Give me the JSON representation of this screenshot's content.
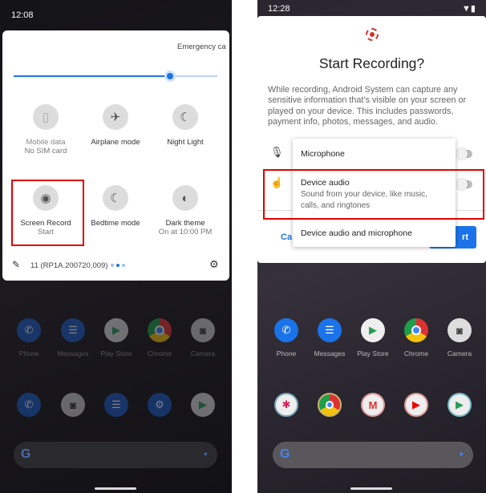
{
  "left": {
    "status_time": "12:08",
    "emergency": "Emergency ca",
    "brightness_percent": 77,
    "tiles": [
      {
        "label": "Mobile data",
        "sub": "No SIM card",
        "icon": "no-sim-icon"
      },
      {
        "label": "Airplane mode",
        "sub": "",
        "icon": "airplane-icon"
      },
      {
        "label": "Night Light",
        "sub": "",
        "icon": "moon-icon"
      },
      {
        "label": "Screen Record",
        "sub": "Start",
        "icon": "screen-record-icon"
      },
      {
        "label": "Bedtime mode",
        "sub": "",
        "icon": "bedtime-icon"
      },
      {
        "label": "Dark theme",
        "sub": "On at 10:00 PM",
        "icon": "dark-theme-icon"
      }
    ],
    "build": "11 (RP1A.200720.009)",
    "apps_row1": [
      "Phone",
      "Messages",
      "Play Store",
      "Chrome",
      "Camera"
    ]
  },
  "right": {
    "status_time": "12:28",
    "dialog_title": "Start Recording?",
    "dialog_body": "While recording, Android System can capture any sensitive information that’s visible on your screen or played on your device. This includes passwords, payment info, photos, messages, and audio.",
    "menu": [
      {
        "label": "Microphone"
      },
      {
        "label": "Device audio",
        "sub": "Sound from your device, like music, calls, and ringtones"
      },
      {
        "label": "Device audio and microphone"
      }
    ],
    "cancel": "Ca",
    "start": "rt",
    "apps_row1": [
      "Phone",
      "Messages",
      "Play Store",
      "Chrome",
      "Camera"
    ]
  },
  "colors": {
    "accent": "#1a73e8",
    "highlight": "#e00000",
    "record": "#d32f2f"
  }
}
